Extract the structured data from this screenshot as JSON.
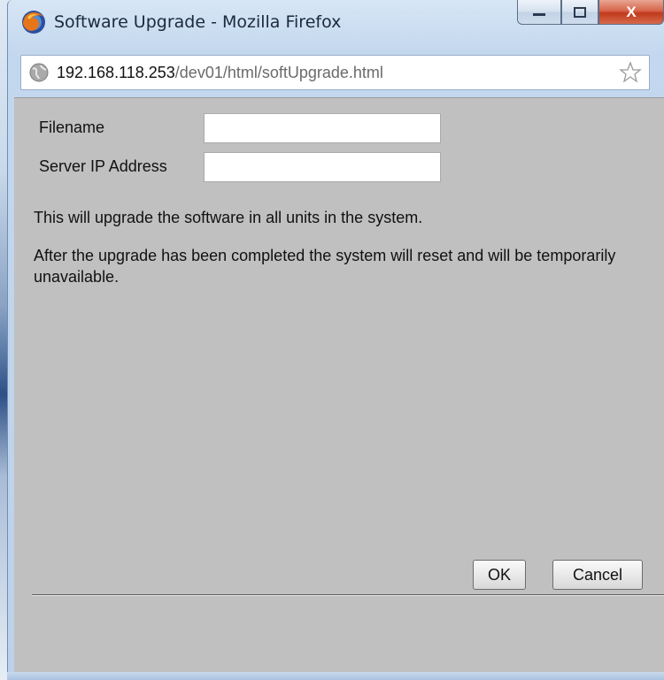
{
  "window": {
    "title": "Software Upgrade - Mozilla Firefox",
    "controls": {
      "minimize": "—",
      "maximize": "▢",
      "close": "X"
    }
  },
  "urlbar": {
    "host": "192.168.118.253",
    "path": "/dev01/html/softUpgrade.html"
  },
  "form": {
    "filename_label": "Filename",
    "filename_value": "",
    "server_ip_label": "Server IP Address",
    "server_ip_value": ""
  },
  "messages": {
    "line1": "This will upgrade the software in all units in the system.",
    "line2": "After the upgrade has been completed the system will reset and will be temporarily unavailable."
  },
  "buttons": {
    "ok": "OK",
    "cancel": "Cancel"
  },
  "colors": {
    "content_bg": "#c0c0c0",
    "close_button": "#c2391c"
  }
}
